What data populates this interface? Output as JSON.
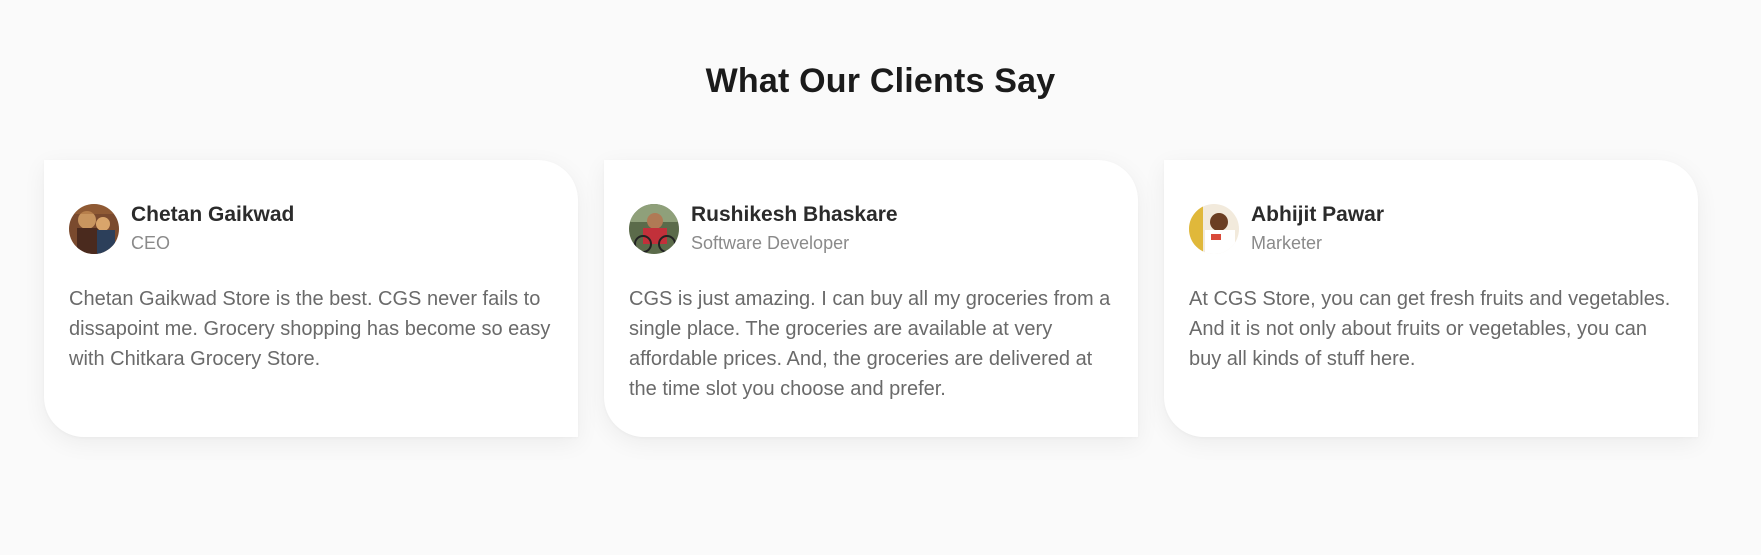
{
  "section": {
    "title": "What Our Clients Say"
  },
  "testimonials": [
    {
      "name": "Chetan Gaikwad",
      "role": "CEO",
      "text": "Chetan Gaikwad Store is the best. CGS never fails to dissapoint me. Grocery shopping has become so easy with Chitkara Grocery Store.",
      "avatar": "person-photo"
    },
    {
      "name": "Rushikesh Bhaskare",
      "role": "Software Developer",
      "text": "CGS is just amazing. I can buy all my groceries from a single place. The groceries are available at very affordable prices. And, the groceries are delivered at the time slot you choose and prefer.",
      "avatar": "person-photo"
    },
    {
      "name": "Abhijit Pawar",
      "role": "Marketer",
      "text": "At CGS Store, you can get fresh fruits and vegetables. And it is not only about fruits or vegetables, you can buy all kinds of stuff here.",
      "avatar": "person-photo"
    }
  ],
  "colors": {
    "background": "#fafafa",
    "card": "#ffffff",
    "title": "#1b1b1b",
    "name": "#2b2b2b",
    "role": "#8a8a8a",
    "text": "#6a6a6a"
  }
}
